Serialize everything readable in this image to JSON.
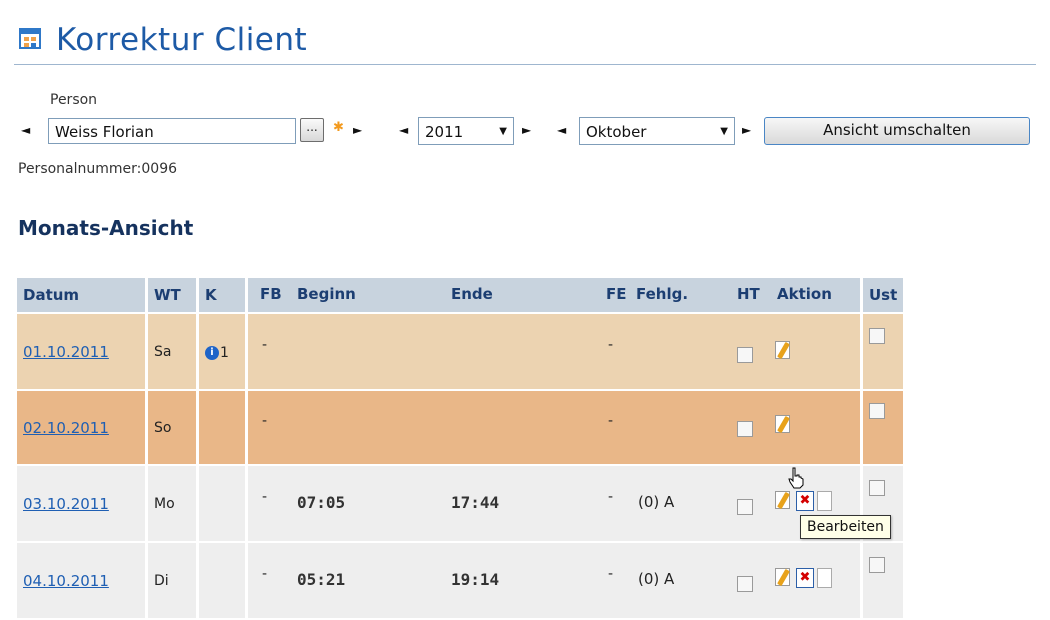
{
  "header": {
    "title": "Korrektur Client"
  },
  "filters": {
    "person_label": "Person",
    "person_value": "Weiss Florian",
    "person_picker_label": "...",
    "year_value": "2011",
    "month_value": "Oktober",
    "switch_view_label": "Ansicht umschalten",
    "personnel_number": "Personalnummer:0096"
  },
  "section": {
    "title": "Monats-Ansicht"
  },
  "table": {
    "columns": [
      "Datum",
      "WT",
      "K",
      "FB",
      "Beginn",
      "Ende",
      "FE",
      "Fehlg.",
      "HT",
      "Aktion",
      "Ust"
    ],
    "rows": [
      {
        "datum": "01.10.2011",
        "wt": "Sa",
        "k": "1",
        "fb": "-",
        "beginn": "",
        "ende": "",
        "fe": "-",
        "fehlg": ""
      },
      {
        "datum": "02.10.2011",
        "wt": "So",
        "k": "",
        "fb": "-",
        "beginn": "",
        "ende": "",
        "fe": "-",
        "fehlg": ""
      },
      {
        "datum": "03.10.2011",
        "wt": "Mo",
        "k": "",
        "fb": "-",
        "beginn": "07:05",
        "ende": "17:44",
        "fe": "-",
        "fehlg": "(0) A"
      },
      {
        "datum": "04.10.2011",
        "wt": "Di",
        "k": "",
        "fb": "-",
        "beginn": "05:21",
        "ende": "19:14",
        "fe": "-",
        "fehlg": "(0) A"
      }
    ]
  },
  "tooltip": {
    "text": "Bearbeiten"
  },
  "colors": {
    "header_bg": "#c8d3de",
    "saturday_bg": "#ecd3b1",
    "sunday_bg": "#e9b788",
    "weekday_bg": "#eeeeee",
    "link": "#1f5fb3",
    "title": "#1d5aa6"
  },
  "icons": [
    "calendar-app-icon",
    "arrow-left-icon",
    "arrow-right-icon",
    "asterisk-icon",
    "chevron-down-icon",
    "info-icon",
    "edit-icon",
    "delete-icon",
    "document-icon",
    "hand-cursor-icon"
  ]
}
